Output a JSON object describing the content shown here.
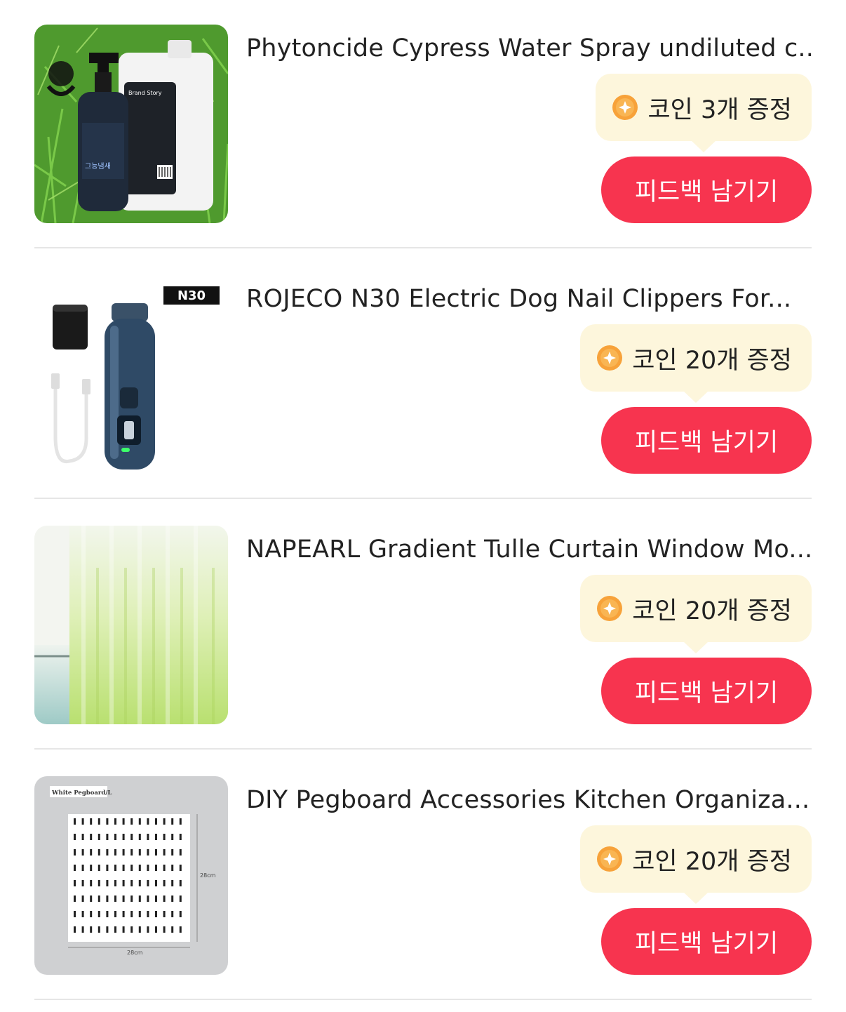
{
  "items": [
    {
      "title": "Phytoncide Cypress Water Spray undiluted c...",
      "coin_text": "코인 3개 증정",
      "button_label": "피드백 남기기",
      "thumb_labels": [
        "Brand Story",
        "그능냄새"
      ]
    },
    {
      "title": "ROJECO N30 Electric Dog Nail Clippers For...",
      "coin_text": "코인 20개 증정",
      "button_label": "피드백 남기기",
      "thumb_labels": [
        "N30"
      ]
    },
    {
      "title": "NAPEARL Gradient Tulle Curtain Window Mo...",
      "coin_text": "코인 20개 증정",
      "button_label": "피드백 남기기",
      "thumb_labels": []
    },
    {
      "title": "DIY Pegboard Accessories Kitchen Organiza...",
      "coin_text": "코인 20개 증정",
      "button_label": "피드백 남기기",
      "thumb_labels": [
        "White Pegboard/L",
        "28cm",
        "28cm"
      ]
    }
  ],
  "colors": {
    "button_bg": "#f7344f",
    "badge_bg": "#fdf6dc",
    "coin": "#f7a23a",
    "divider": "#e6e6e6"
  },
  "icons": {
    "coin": "coin-icon"
  }
}
